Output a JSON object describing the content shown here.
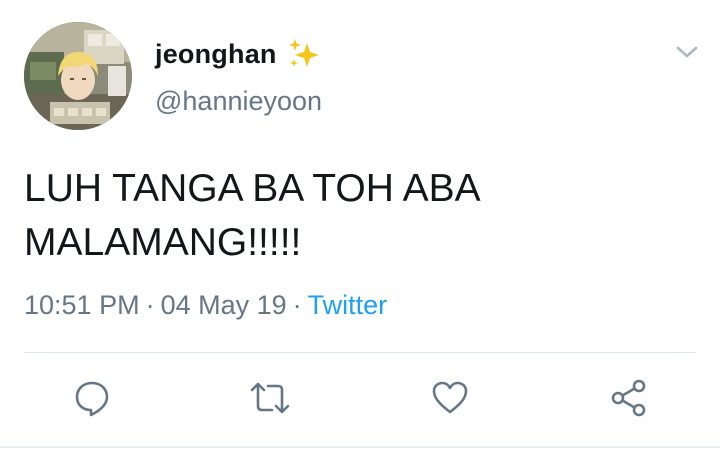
{
  "tweet": {
    "display_name": "jeonghan",
    "name_emoji": "sparkles-icon",
    "handle": "@hannieyoon",
    "text": "LUH TANGA BA TOH ABA\nMALAMANG!!!!!",
    "time": "10:51 PM",
    "separator": "·",
    "date": "04 May 19",
    "source": "Twitter"
  },
  "actions": [
    {
      "name": "reply",
      "icon": "reply-icon"
    },
    {
      "name": "retweet",
      "icon": "retweet-icon"
    },
    {
      "name": "like",
      "icon": "heart-icon"
    },
    {
      "name": "share",
      "icon": "share-icon"
    }
  ],
  "colors": {
    "text": "#14171a",
    "secondary": "#657786",
    "link": "#1da1f2",
    "icon": "#657786",
    "divider": "#e1e8ed",
    "sparkle": "#f5c518"
  }
}
